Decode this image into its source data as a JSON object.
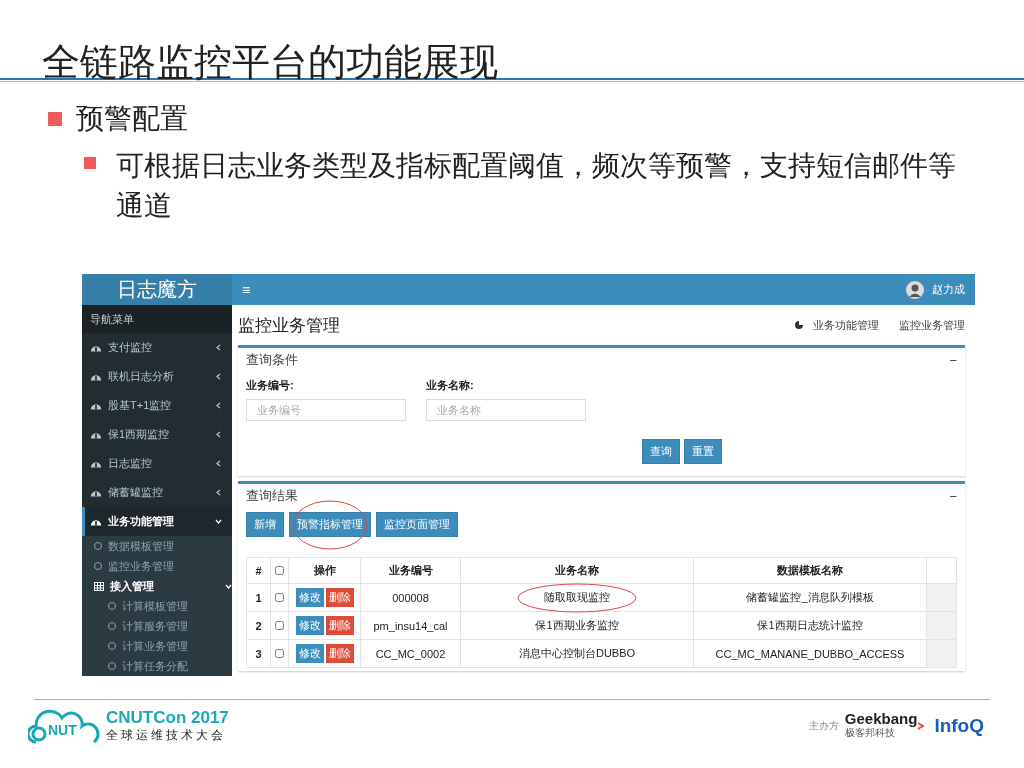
{
  "slide": {
    "title": "全链路监控平台的功能展现",
    "bullets": [
      {
        "text": "预警配置",
        "children": [
          {
            "text": "可根据日志业务类型及指标配置阈值，频次等预警，支持短信邮件等通道"
          }
        ]
      }
    ]
  },
  "app": {
    "logo": "日志魔方",
    "menu_toggle": "≡",
    "user_name": "赵力成",
    "sidebar": {
      "heading": "导航菜单",
      "items": [
        {
          "label": "支付监控",
          "selected": false,
          "expanded": false
        },
        {
          "label": "联机日志分析",
          "selected": false,
          "expanded": false
        },
        {
          "label": "股基T+1监控",
          "selected": false,
          "expanded": false
        },
        {
          "label": "保1西期监控",
          "selected": false,
          "expanded": false
        },
        {
          "label": "日志监控",
          "selected": false,
          "expanded": false
        },
        {
          "label": "储蓄罐监控",
          "selected": false,
          "expanded": false
        },
        {
          "label": "业务功能管理",
          "selected": true,
          "expanded": true,
          "children": [
            {
              "label": "数据模板管理"
            },
            {
              "label": "监控业务管理"
            },
            {
              "label": "接入管理",
              "expanded": true,
              "children": [
                {
                  "label": "计算模板管理"
                },
                {
                  "label": "计算服务管理"
                },
                {
                  "label": "计算业务管理"
                },
                {
                  "label": "计算任务分配"
                }
              ]
            }
          ]
        }
      ]
    },
    "page_title": "监控业务管理",
    "breadcrumb": [
      "业务功能管理",
      "监控业务管理"
    ],
    "query_panel": {
      "title": "查询条件",
      "collapse": "−",
      "fields": [
        {
          "label": "业务编号:",
          "placeholder": "业务编号"
        },
        {
          "label": "业务名称:",
          "placeholder": "业务名称"
        }
      ],
      "buttons": [
        "查询",
        "重置"
      ]
    },
    "result_panel": {
      "title": "查询结果",
      "collapse": "−",
      "buttons": [
        {
          "label": "新增",
          "circled": false
        },
        {
          "label": "预警指标管理",
          "circled": true
        },
        {
          "label": "监控页面管理",
          "circled": false
        }
      ],
      "table": {
        "header_checked": false,
        "columns": [
          "#",
          "操作",
          "业务编号",
          "业务名称",
          "数据模板名称"
        ],
        "rows": [
          {
            "index": "1",
            "checked": false,
            "actions": [
              "修改",
              "删除"
            ],
            "code": "000008",
            "name": "随取取现监控",
            "name_circled": true,
            "template": "储蓄罐监控_消息队列模板"
          },
          {
            "index": "2",
            "checked": false,
            "actions": [
              "修改",
              "删除"
            ],
            "code": "pm_insu14_cal",
            "name": "保1西期业务监控",
            "name_circled": false,
            "template": "保1西期日志统计监控"
          },
          {
            "index": "3",
            "checked": false,
            "actions": [
              "修改",
              "删除"
            ],
            "code": "CC_MC_0002",
            "name": "消息中心控制台DUBBO",
            "name_circled": false,
            "template": "CC_MC_MANANE_DUBBO_ACCESS"
          }
        ]
      }
    }
  },
  "footer": {
    "logo_letters": "NUT",
    "conference": "CNUTCon 2017",
    "conference_subtitle": "全球运维技术大会",
    "organizer_label": "主办方",
    "sponsor": "Geekbang",
    "sponsor_subtitle": "极客邦科技",
    "partner": "InfoQ"
  }
}
